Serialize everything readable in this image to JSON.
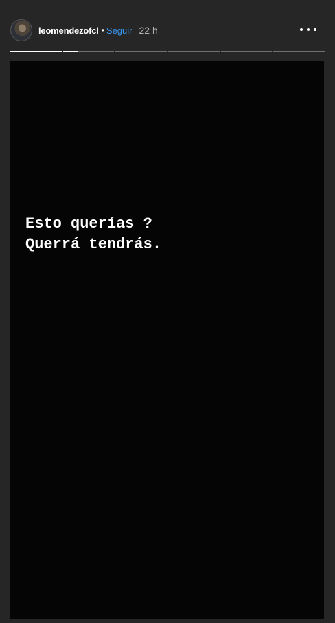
{
  "header": {
    "username": "leomendezofcl",
    "separator": "•",
    "follow_label": "Seguir",
    "time": "22 h",
    "more_icon": "more-horizontal-icon",
    "follow_color": "#3897f0"
  },
  "progress": {
    "segments": [
      {
        "fill": 1.0
      },
      {
        "fill": 0.28
      },
      {
        "fill": 0
      },
      {
        "fill": 0
      },
      {
        "fill": 0
      },
      {
        "fill": 0
      }
    ]
  },
  "story": {
    "line1": "Esto querías ?",
    "line2": "Querrá tendrás."
  }
}
